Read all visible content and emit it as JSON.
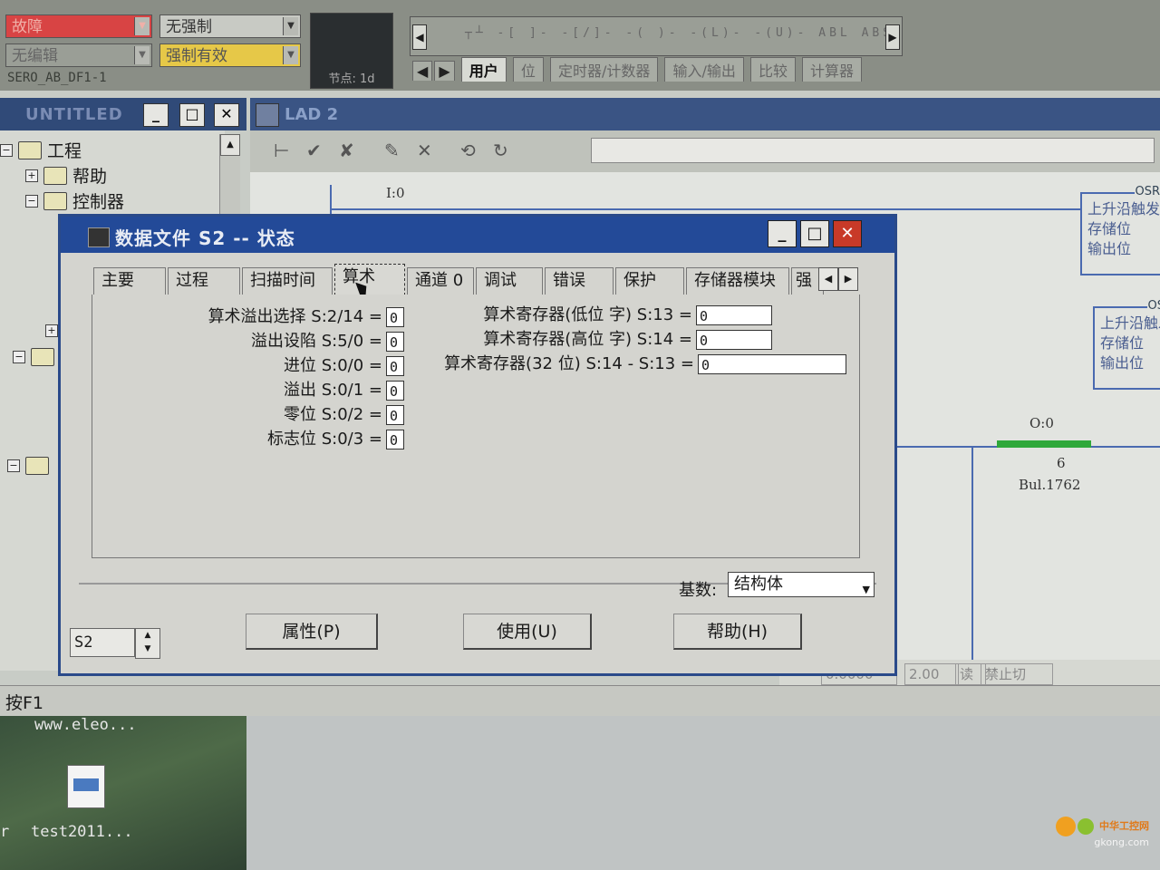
{
  "toolbar": {
    "mode_fault": "故障",
    "mode_noedit": "无编辑",
    "force_none": "无强制",
    "force_active": "强制有效",
    "driver_caption": "SERO_AB_DF1-1",
    "node_label": "节点: 1d",
    "instr_glyphs": "┬┴ -[ ]- -[/]- -( )- -(L)- -(U)- ABL ABS",
    "instr_tabs": [
      "用户",
      "位",
      "定时器/计数器",
      "输入/输出",
      "比较",
      "计算器"
    ],
    "colors": {
      "fault": "#d84444",
      "force_active": "#e6c848"
    }
  },
  "project_window": {
    "title": "UNTITLED",
    "tree": [
      {
        "label": "工程"
      },
      {
        "label": "帮助"
      },
      {
        "label": "控制器"
      }
    ]
  },
  "lad_window": {
    "title": "LAD 2",
    "input_label": "I:0",
    "osr_header": "OSR",
    "osr_lines": [
      "上升沿触发",
      "存储位",
      "输出位"
    ],
    "osr_lines_2": [
      "上升沿触发",
      "存储位",
      "输出位"
    ],
    "output_address": "O:0",
    "output_bit": "6",
    "output_device": "Bul.1762",
    "status_fields": [
      "0.0000",
      "2.00",
      "读",
      "禁止切"
    ]
  },
  "dialog": {
    "title": "数据文件  S2  --  状态",
    "tabs": [
      "主要",
      "过程",
      "扫描时间",
      "算术",
      "通道 0",
      "调试",
      "错误",
      "保护",
      "存储器模块",
      "强"
    ],
    "active_tab": "算术",
    "left_fields": [
      {
        "label": "算术溢出选择 S:2/14 =",
        "value": "0"
      },
      {
        "label": "溢出设陷 S:5/0 =",
        "value": "0"
      },
      {
        "label": "进位 S:0/0 =",
        "value": "0"
      },
      {
        "label": "溢出 S:0/1 =",
        "value": "0"
      },
      {
        "label": "零位 S:0/2 =",
        "value": "0"
      },
      {
        "label": "标志位 S:0/3 =",
        "value": "0"
      }
    ],
    "right_fields": [
      {
        "label": "算术寄存器(低位 字) S:13 =",
        "value": "0"
      },
      {
        "label": "算术寄存器(高位 字) S:14 =",
        "value": "0"
      },
      {
        "label": "算术寄存器(32 位)  S:14 - S:13 =",
        "value": "0"
      }
    ],
    "radix_label": "基数:",
    "radix_value": "结构体",
    "file_value": "S2",
    "buttons": {
      "properties": "属性(P)",
      "use": "使用(U)",
      "help": "帮助(H)"
    }
  },
  "statusbar": {
    "hint": "按F1"
  },
  "desktop": {
    "text_top": "www.eleo...",
    "text_left": "r",
    "icon_label": "test2011...",
    "watermark": "中华工控网",
    "watermark_url": "gkong.com"
  }
}
